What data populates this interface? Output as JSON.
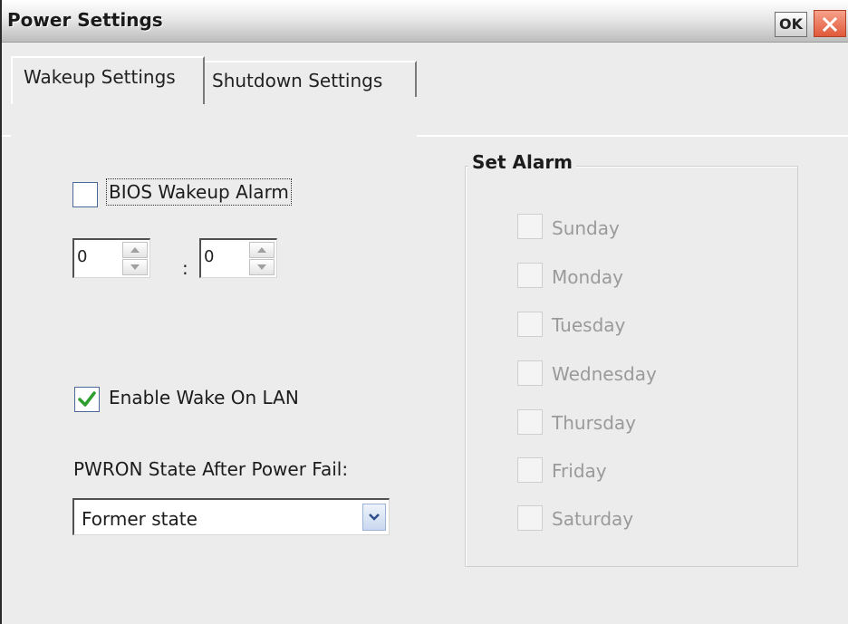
{
  "window": {
    "title": "Power Settings",
    "ok_label": "OK"
  },
  "tabs": [
    {
      "label": "Wakeup Settings",
      "selected": true
    },
    {
      "label": "Shutdown Settings",
      "selected": false
    }
  ],
  "wakeup": {
    "bios_alarm_label": "BIOS Wakeup Alarm",
    "bios_alarm_checked": false,
    "hour_value": "0",
    "minute_value": "0",
    "separator": ":",
    "wol_label": "Enable Wake On LAN",
    "wol_checked": true,
    "pwron_label": "PWRON State After Power Fail:",
    "pwron_value": "Former state"
  },
  "alarm": {
    "group_title": "Set Alarm",
    "days": [
      {
        "label": "Sunday",
        "checked": false
      },
      {
        "label": "Monday",
        "checked": false
      },
      {
        "label": "Tuesday",
        "checked": false
      },
      {
        "label": "Wednesday",
        "checked": false
      },
      {
        "label": "Thursday",
        "checked": false
      },
      {
        "label": "Friday",
        "checked": false
      },
      {
        "label": "Saturday",
        "checked": false
      }
    ]
  },
  "colors": {
    "check_green": "#2e9e2e",
    "close_red": "#e0583a",
    "disabled_text": "#9a9a9a"
  },
  "icons": {
    "close": "close-icon",
    "check": "checkmark-icon",
    "spin_up": "arrow-up-icon",
    "spin_down": "arrow-down-icon",
    "dropdown": "chevron-down-icon"
  }
}
